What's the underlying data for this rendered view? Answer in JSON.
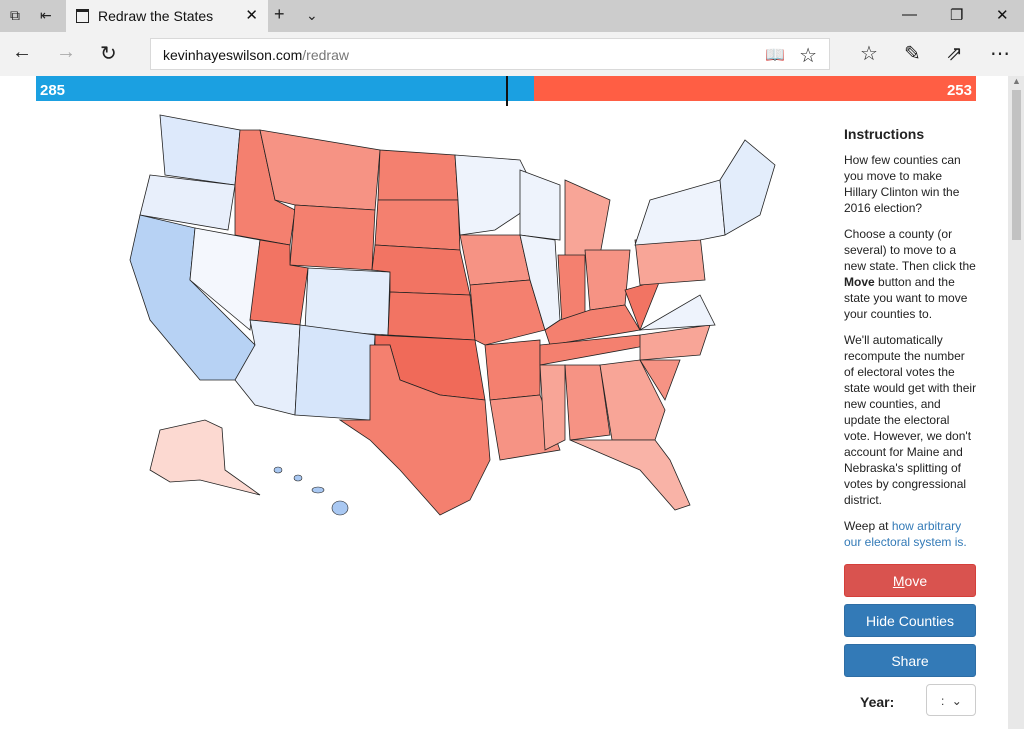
{
  "browser": {
    "tab_title": "Redraw the States",
    "url_domain": "kevinhayeswilson.com",
    "url_path": "/redraw"
  },
  "electoral": {
    "dem_votes": "285",
    "rep_votes": "253",
    "dem_share": 0.53,
    "dem_color": "#1ba0e1",
    "rep_color": "#ff5e44"
  },
  "instructions": {
    "heading": "Instructions",
    "p1": "How few counties can you move to make Hillary Clinton win the 2016 election?",
    "p2_a": "Choose a county (or several) to move to a new state. Then click the ",
    "p2_bold": "Move",
    "p2_b": " button and the state you want to move your counties to.",
    "p3": "We'll automatically recompute the number of electoral votes the state would get with their new counties, and update the electoral vote. However, we don't account for Maine and Nebraska's splitting of votes by congressional district.",
    "p4_a": "Weep at ",
    "p4_link": "how arbitrary our electoral system is."
  },
  "buttons": {
    "move_u": "M",
    "move_rest": "ove",
    "hide": "Hide Counties",
    "share": "Share"
  },
  "year": {
    "label": "Year:",
    "value": ":"
  }
}
